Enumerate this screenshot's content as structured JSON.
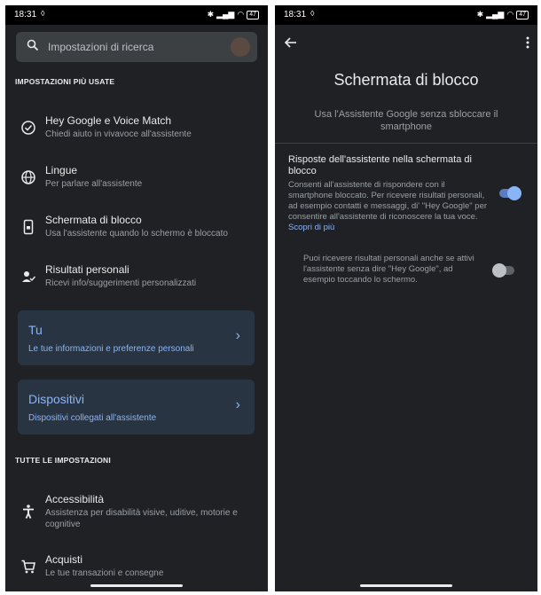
{
  "status": {
    "time": "18:31",
    "battery": "47"
  },
  "left": {
    "search_placeholder": "Impostazioni di ricerca",
    "section_most_used": "IMPOSTAZIONI PIÙ USATE",
    "items": [
      {
        "title": "Hey Google e Voice Match",
        "subtitle": "Chiedi aiuto in vivavoce all'assistente",
        "icon": "voice-match-icon"
      },
      {
        "title": "Lingue",
        "subtitle": "Per parlare all'assistente",
        "icon": "globe-icon"
      },
      {
        "title": "Schermata di blocco",
        "subtitle": "Usa l'assistente quando lo schermo è bloccato",
        "icon": "lock-screen-icon"
      },
      {
        "title": "Risultati personali",
        "subtitle": "Ricevi info/suggerimenti personalizzati",
        "icon": "person-check-icon"
      }
    ],
    "cards": [
      {
        "title": "Tu",
        "subtitle": "Le tue informazioni e preferenze personali"
      },
      {
        "title": "Dispositivi",
        "subtitle": "Dispositivi collegati all'assistente"
      }
    ],
    "section_all": "TUTTE LE IMPOSTAZIONI",
    "all_items": [
      {
        "title": "Accessibilità",
        "subtitle": "Assistenza per disabilità visive, uditive, motorie e cognitive",
        "icon": "accessibility-icon"
      },
      {
        "title": "Acquisti",
        "subtitle": "Le tue transazioni e consegne",
        "icon": "cart-icon"
      }
    ]
  },
  "right": {
    "title": "Schermata di blocco",
    "subtitle": "Usa l'Assistente Google senza sbloccare il smartphone",
    "option1": {
      "title": "Risposte dell'assistente nella schermata di blocco",
      "description": "Consenti all'assistente di rispondere con il smartphone bloccato. Per ricevere risultati personali, ad esempio contatti e messaggi, di' \"Hey Google\" per consentire all'assistente di riconoscere la tua voce.",
      "link": "Scopri di più",
      "enabled": true
    },
    "option2": {
      "description": "Puoi ricevere risultati personali anche se attivi l'assistente senza dire \"Hey Google\", ad esempio toccando lo schermo.",
      "enabled": false
    }
  }
}
